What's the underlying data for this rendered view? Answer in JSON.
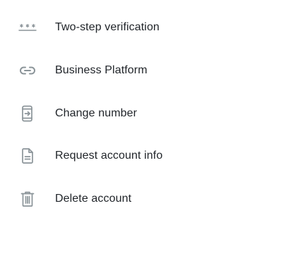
{
  "settings": {
    "items": [
      {
        "label": "Two-step verification",
        "icon": "password-asterisks-icon"
      },
      {
        "label": "Business Platform",
        "icon": "link-icon"
      },
      {
        "label": "Change number",
        "icon": "phone-transfer-icon"
      },
      {
        "label": "Request account info",
        "icon": "document-icon"
      },
      {
        "label": "Delete account",
        "icon": "trash-icon"
      }
    ],
    "icon_color": "#8b9499",
    "text_color": "#1f2328"
  }
}
